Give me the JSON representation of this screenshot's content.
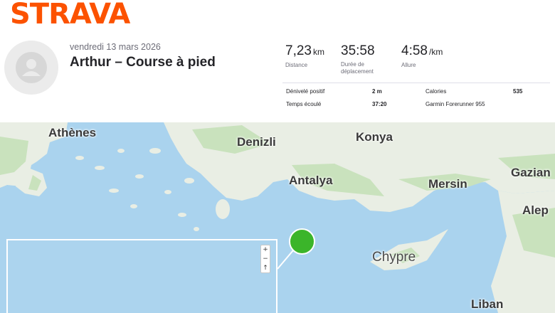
{
  "brand": {
    "logo": "STRAVA",
    "color": "#fc5200"
  },
  "activity": {
    "date": "vendredi 13 mars 2026",
    "title": "Arthur – Course à pied",
    "avatar_icon": "user-silhouette-icon"
  },
  "stats": {
    "distance": {
      "value": "7,23",
      "unit": "km",
      "label": "Distance"
    },
    "moving_time": {
      "value": "35:58",
      "label": "Durée de déplacement"
    },
    "pace": {
      "value": "4:58",
      "unit": "/km",
      "label": "Allure"
    }
  },
  "details": {
    "elevation_label": "Dénivelé positif",
    "elevation_value": "2 m",
    "elapsed_label": "Temps écoulé",
    "elapsed_value": "37:20",
    "calories_label": "Calories",
    "calories_value": "535",
    "device": "Garmin Forerunner 955"
  },
  "map": {
    "labels": {
      "athens": "Athènes",
      "denizli": "Denizli",
      "konya": "Konya",
      "antalya": "Antalya",
      "mersin": "Mersin",
      "gaziantep": "Gazian",
      "aleppo": "Alep",
      "cyprus": "Chypre",
      "lebanon": "Liban"
    },
    "zoom_in": "+",
    "zoom_out": "−",
    "reset": "↑",
    "colors": {
      "sea": "#aad3ee",
      "land": "#e9eee4",
      "forest": "#c9e2bd",
      "marker": "#3bb52a"
    }
  }
}
